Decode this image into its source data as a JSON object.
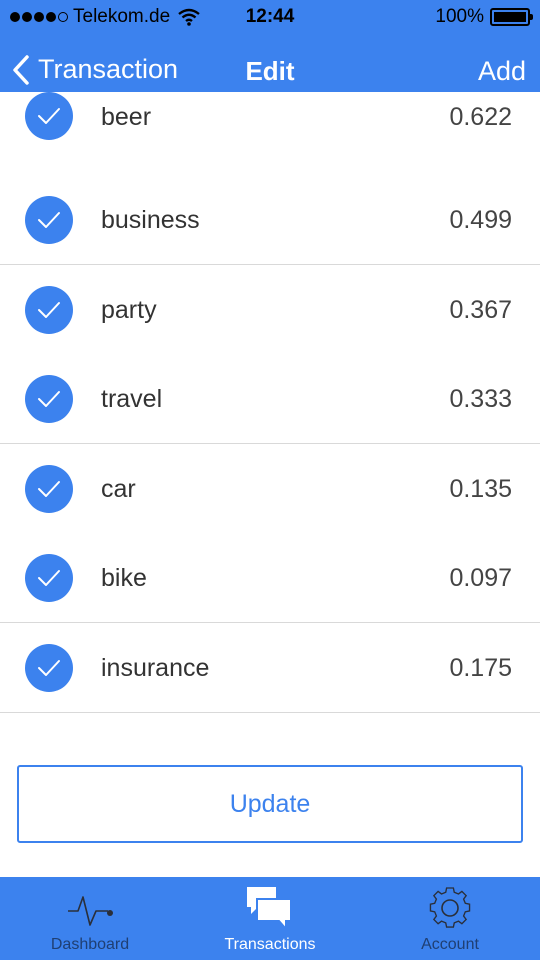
{
  "status_bar": {
    "carrier": "Telekom.de",
    "time": "12:44",
    "battery": "100%",
    "battery_level": 1.0,
    "signal_bars": 4
  },
  "nav": {
    "back_label": "Transaction",
    "title": "Edit",
    "add_label": "Add"
  },
  "items": [
    {
      "label": "beer",
      "value": "0.622",
      "checked": true
    },
    {
      "label": "business",
      "value": "0.499",
      "checked": true
    },
    {
      "label": "party",
      "value": "0.367",
      "checked": true
    },
    {
      "label": "travel",
      "value": "0.333",
      "checked": true
    },
    {
      "label": "car",
      "value": "0.135",
      "checked": true
    },
    {
      "label": "bike",
      "value": "0.097",
      "checked": true
    },
    {
      "label": "insurance",
      "value": "0.175",
      "checked": true
    }
  ],
  "update_label": "Update",
  "tabs": [
    {
      "label": "Dashboard",
      "icon": "pulse-icon",
      "active": false
    },
    {
      "label": "Transactions",
      "icon": "chat-bubbles-icon",
      "active": true
    },
    {
      "label": "Account",
      "icon": "gear-icon",
      "active": false
    }
  ],
  "colors": {
    "accent": "#3c82ee",
    "inactive_tab": "#1f3f73",
    "active_tab": "#ffffff"
  }
}
